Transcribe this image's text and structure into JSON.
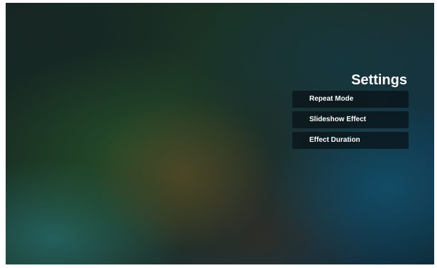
{
  "settings": {
    "title": "Settings",
    "items": [
      {
        "label": "Repeat Mode"
      },
      {
        "label": "Slideshow Effect"
      },
      {
        "label": "Effect Duration"
      }
    ]
  }
}
